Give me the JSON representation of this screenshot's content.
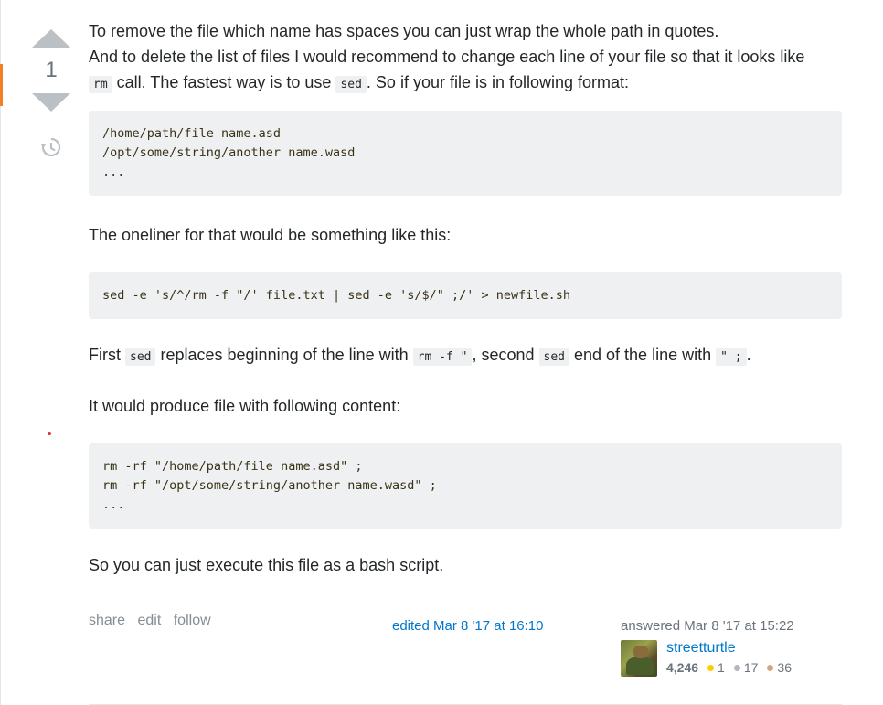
{
  "vote": {
    "count": "1"
  },
  "answer": {
    "p1_line1": "To remove the file which name has spaces you can just wrap the whole path in quotes.",
    "p1_line2": "And to delete the list of files I would recommend to change each line of your file so that it looks like",
    "p1_code_rm": "rm",
    "p1_text_a": " call. The fastest way is to use ",
    "p1_code_sed": "sed",
    "p1_text_b": ". So if your file is in following format:",
    "code1": "/home/path/file name.asd\n/opt/some/string/another name.wasd\n...",
    "p2": "The oneliner for that would be something like this:",
    "code2": "sed -e 's/^/rm -f \"/' file.txt | sed -e 's/$/\" ;/' > newfile.sh",
    "p3_text_a": "First ",
    "p3_code_sed1": "sed",
    "p3_text_b": " replaces beginning of the line with ",
    "p3_code_rmf": "rm -f \"",
    "p3_text_c": ", second ",
    "p3_code_sed2": "sed",
    "p3_text_d": " end of the line with ",
    "p3_code_semi": "\" ;",
    "p3_text_e": ".",
    "p4": "It would produce file with following content:",
    "code3": "rm -rf \"/home/path/file name.asd\" ;\nrm -rf \"/opt/some/string/another name.wasd\" ;\n...",
    "p5": "So you can just execute this file as a bash script."
  },
  "footer": {
    "share": "share",
    "edit": "edit",
    "follow": "follow",
    "edited": "edited Mar 8 '17 at 16:10",
    "answered": "answered Mar 8 '17 at 15:22",
    "username": "streetturtle",
    "reputation": "4,246",
    "gold": "1",
    "silver": "17",
    "bronze": "36"
  },
  "icons": {
    "vote_up": "arrow-up-icon",
    "vote_down": "arrow-down-icon",
    "history": "history-icon"
  },
  "colors": {
    "accent": "#f48024",
    "link": "#0077cc",
    "code_bg": "#eff0f1"
  }
}
